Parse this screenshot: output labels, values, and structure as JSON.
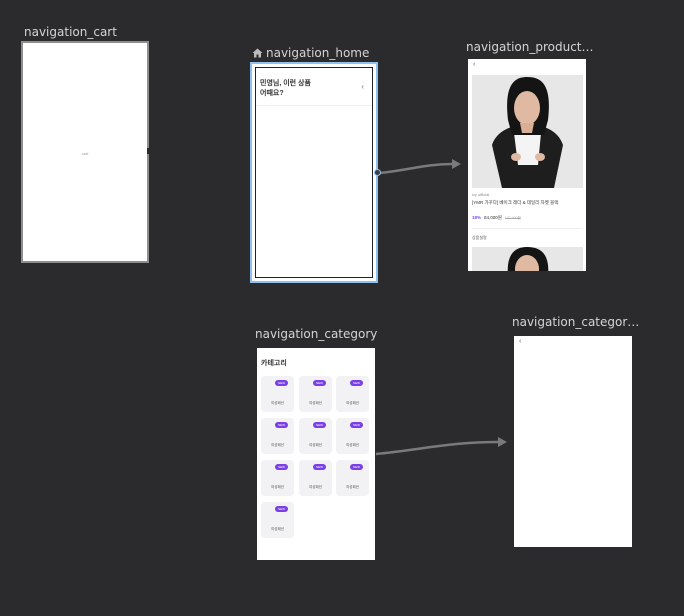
{
  "graph": {
    "destinations": {
      "cart": {
        "name": "navigation_cart",
        "placeholder": "cart"
      },
      "home": {
        "name": "navigation_home",
        "is_start": true,
        "title_line1": "민영님, 이런 상품",
        "title_line2": "어때요?",
        "chevron": "‹"
      },
      "product": {
        "name": "navigation_product…",
        "back": "‹",
        "shop": "ivy official",
        "product_name": "[YMR 가꾸다] 베이크 레더 & 데일리 자켓 블랙",
        "discount": "18%",
        "price": "84,000원",
        "original_price": "102,400원",
        "detail_label": "상품설명"
      },
      "category": {
        "name": "navigation_category",
        "title": "카테고리",
        "badge_label": "NEW",
        "tiles": [
          "여성패션",
          "여성패션",
          "여성패션",
          "여성패션",
          "여성패션",
          "여성패션",
          "여성패션",
          "여성패션",
          "여성패션",
          "여성패션"
        ]
      },
      "category_detail": {
        "name": "navigation_categor…",
        "back": "‹"
      }
    }
  },
  "colors": {
    "canvas_bg": "#2b2b2d",
    "selected_border": "#8fc1ef",
    "action_line": "#7a7a7a",
    "badge_purple": "#7a3fe6"
  },
  "icons": {
    "start_destination": "home-icon"
  }
}
